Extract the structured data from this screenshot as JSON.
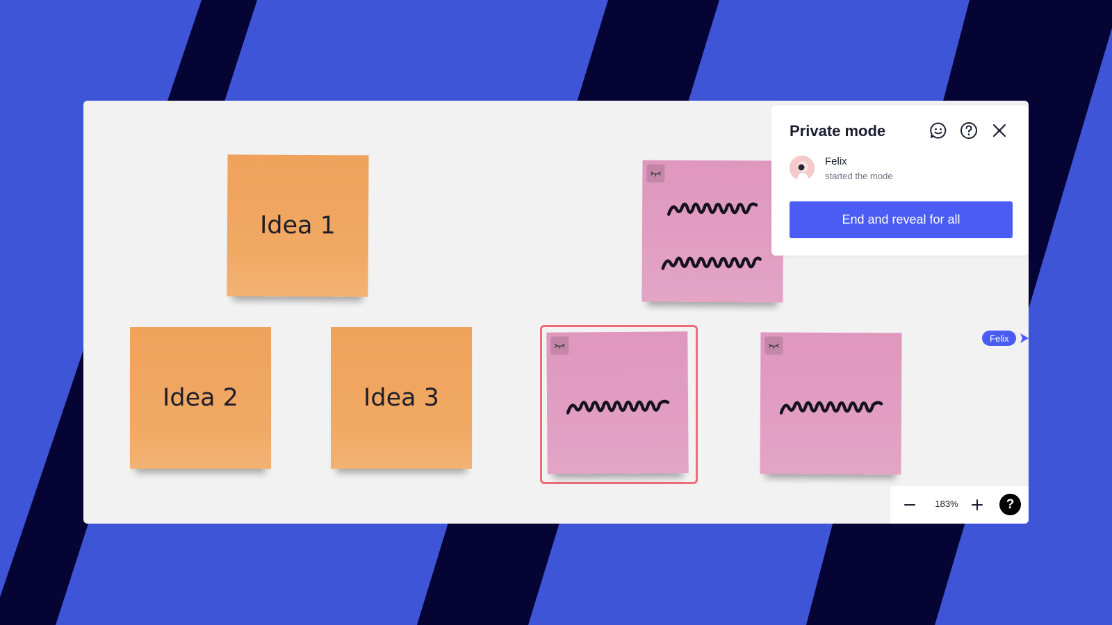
{
  "colors": {
    "background_blue": "#3f55d8",
    "stripe_navy": "#050434",
    "board": "#f2f2f2",
    "sticky_orange": "#f1a862",
    "sticky_pink": "#e09fc2",
    "selection": "#ef6b77",
    "accent": "#4a5cf3"
  },
  "stickies": {
    "idea1": "Idea 1",
    "idea2": "Idea 2",
    "idea3": "Idea 3"
  },
  "private_mode_panel": {
    "title": "Private mode",
    "icons": [
      "emoji-reaction-icon",
      "help-circle-icon",
      "close-icon"
    ],
    "user_name": "Felix",
    "user_status": "started the mode",
    "reveal_button": "End and reveal for all"
  },
  "cursor": {
    "label": "Felix"
  },
  "zoom": {
    "level": "183%",
    "help": "?"
  }
}
